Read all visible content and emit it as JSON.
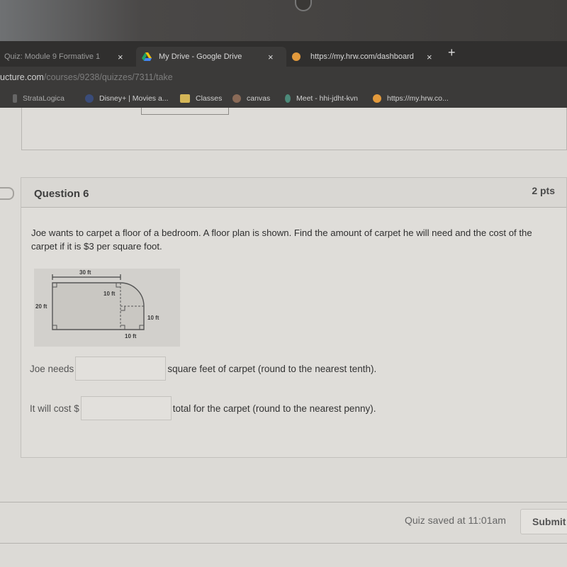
{
  "browser": {
    "tabs": [
      {
        "label": "Quiz: Module 9 Formative 1",
        "icon": "canvas-icon",
        "active": false
      },
      {
        "label": "My Drive - Google Drive",
        "icon": "google-drive-icon",
        "active": true
      },
      {
        "label": "https://my.hrw.com/dashboard",
        "icon": "hrw-icon",
        "active": false
      }
    ],
    "close_glyph": "×",
    "new_tab_glyph": "+",
    "url_domain": "ucture.com",
    "url_path": "/courses/9238/quizzes/7311/take",
    "bookmarks": [
      {
        "label": "StrataLogica",
        "icon": "stratalogica-icon"
      },
      {
        "label": "Disney+ | Movies a...",
        "icon": "disney-icon"
      },
      {
        "label": "Classes",
        "icon": "google-classroom-icon"
      },
      {
        "label": "canvas",
        "icon": "canvas-icon"
      },
      {
        "label": "Meet - hhi-jdht-kvn",
        "icon": "google-meet-icon"
      },
      {
        "label": "https://my.hrw.co...",
        "icon": "hrw-icon"
      }
    ]
  },
  "question": {
    "title": "Question 6",
    "points": "2 pts",
    "text": "Joe wants to carpet a floor of a bedroom. A floor plan is shown. Find the amount of carpet he will need and the cost of the carpet if it is $3 per square foot.",
    "figure": {
      "labels": {
        "top": "30 ft",
        "left": "20 ft",
        "inner": "10 ft",
        "right": "10 ft",
        "bottom": "10 ft"
      }
    },
    "answers": [
      {
        "prefix": "Joe needs",
        "value": "",
        "suffix": "square feet of carpet (round to the nearest tenth)."
      },
      {
        "prefix": "It will cost $",
        "value": "",
        "suffix": "total for the carpet (round to the nearest penny)."
      }
    ]
  },
  "footer": {
    "saved_text": "Quiz saved at 11:01am",
    "submit_label": "Submit"
  }
}
